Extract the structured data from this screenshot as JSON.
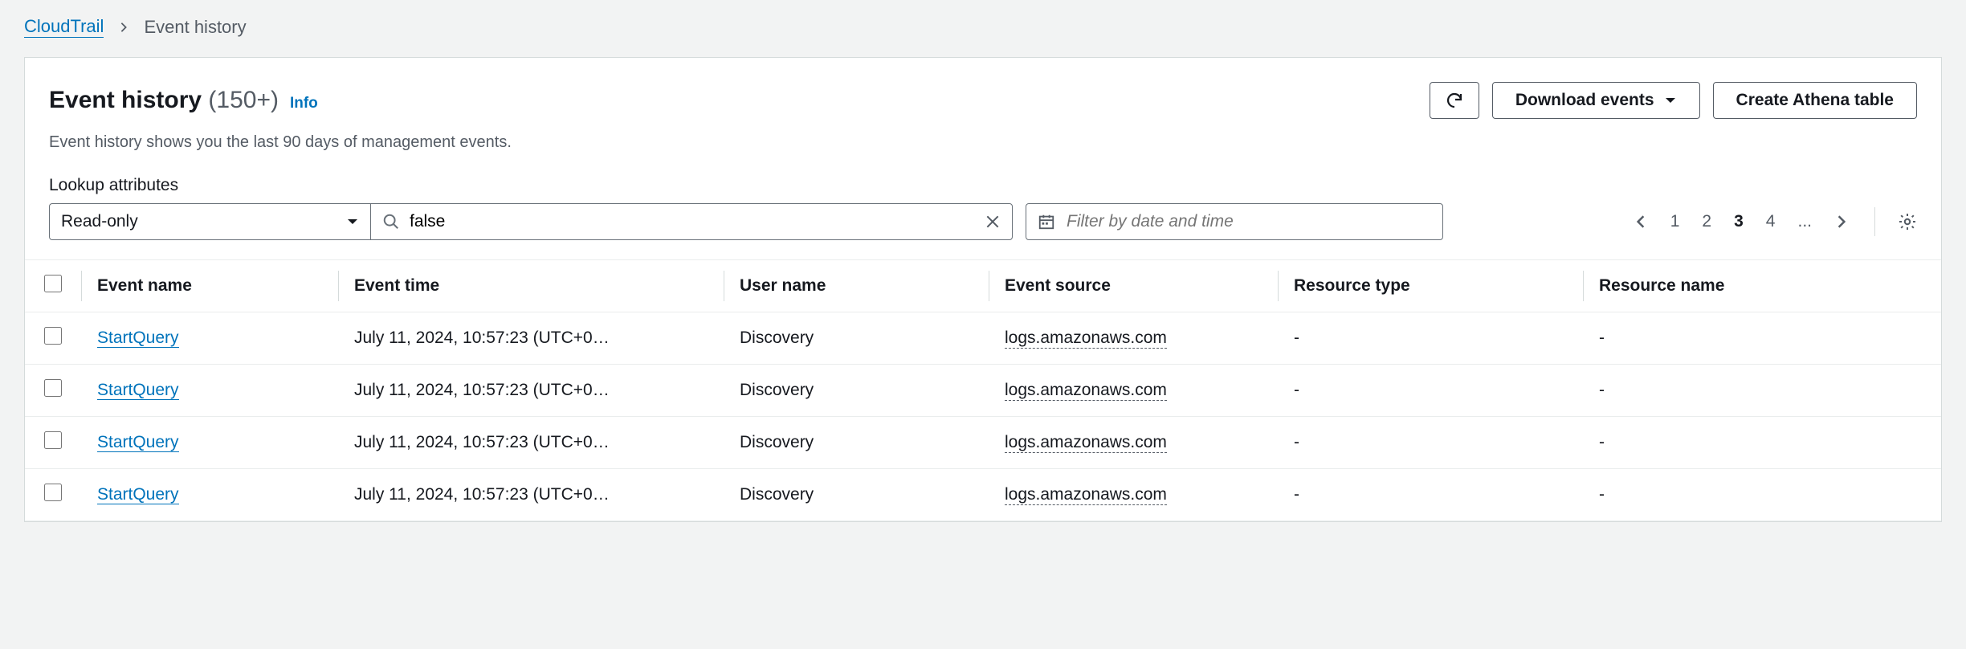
{
  "breadcrumb": {
    "root": "CloudTrail",
    "current": "Event history"
  },
  "header": {
    "title": "Event history",
    "count": "(150+)",
    "info": "Info",
    "subtitle": "Event history shows you the last 90 days of management events.",
    "download": "Download events",
    "create_table": "Create Athena table"
  },
  "filters": {
    "label": "Lookup attributes",
    "attribute": "Read-only",
    "value": "false",
    "date_placeholder": "Filter by date and time"
  },
  "pagination": {
    "pages": [
      "1",
      "2",
      "3",
      "4",
      "..."
    ],
    "active": "3"
  },
  "table": {
    "columns": {
      "event_name": "Event name",
      "event_time": "Event time",
      "user_name": "User name",
      "event_source": "Event source",
      "resource_type": "Resource type",
      "resource_name": "Resource name"
    },
    "rows": [
      {
        "event_name": "StartQuery",
        "event_time": "July 11, 2024, 10:57:23 (UTC+0…",
        "user_name": "Discovery",
        "event_source": "logs.amazonaws.com",
        "resource_type": "-",
        "resource_name": "-"
      },
      {
        "event_name": "StartQuery",
        "event_time": "July 11, 2024, 10:57:23 (UTC+0…",
        "user_name": "Discovery",
        "event_source": "logs.amazonaws.com",
        "resource_type": "-",
        "resource_name": "-"
      },
      {
        "event_name": "StartQuery",
        "event_time": "July 11, 2024, 10:57:23 (UTC+0…",
        "user_name": "Discovery",
        "event_source": "logs.amazonaws.com",
        "resource_type": "-",
        "resource_name": "-"
      },
      {
        "event_name": "StartQuery",
        "event_time": "July 11, 2024, 10:57:23 (UTC+0…",
        "user_name": "Discovery",
        "event_source": "logs.amazonaws.com",
        "resource_type": "-",
        "resource_name": "-"
      }
    ]
  }
}
